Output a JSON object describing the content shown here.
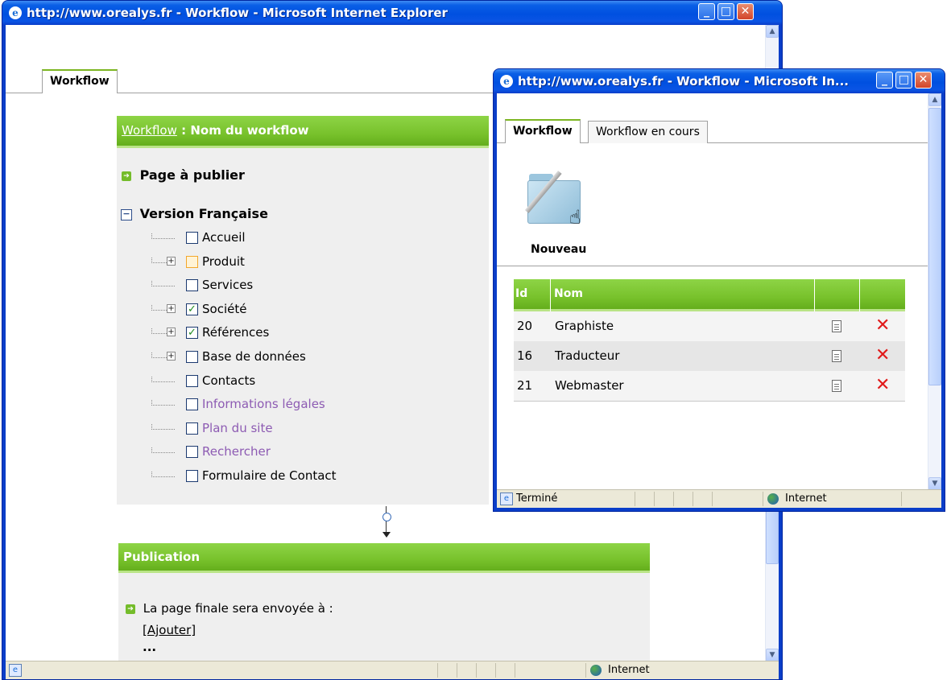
{
  "main_window": {
    "title": "http://www.orealys.fr - Workflow - Microsoft Internet Explorer",
    "tab_label": "Workflow",
    "header": {
      "link": "Workflow",
      "separator": " : ",
      "name": "Nom du workflow"
    },
    "section_page": "Page à publier",
    "section_version": "Version Française",
    "tree_items": [
      {
        "label": "Accueil",
        "expandable": false,
        "checked": false,
        "style": "normal"
      },
      {
        "label": "Produit",
        "expandable": true,
        "checked": false,
        "style": "hover"
      },
      {
        "label": "Services",
        "expandable": false,
        "checked": false,
        "style": "normal"
      },
      {
        "label": "Société",
        "expandable": true,
        "checked": true,
        "style": "normal"
      },
      {
        "label": "Références",
        "expandable": true,
        "checked": true,
        "style": "normal"
      },
      {
        "label": "Base de données",
        "expandable": true,
        "checked": false,
        "style": "normal"
      },
      {
        "label": "Contacts",
        "expandable": false,
        "checked": false,
        "style": "normal"
      },
      {
        "label": "Informations légales",
        "expandable": false,
        "checked": false,
        "style": "purple"
      },
      {
        "label": "Plan du site",
        "expandable": false,
        "checked": false,
        "style": "purple"
      },
      {
        "label": "Rechercher",
        "expandable": false,
        "checked": false,
        "style": "purple"
      },
      {
        "label": "Formulaire de Contact",
        "expandable": false,
        "checked": false,
        "style": "normal"
      }
    ],
    "publication": {
      "title": "Publication",
      "text": "La page finale sera envoyée à :",
      "add_link": "[Ajouter]",
      "ellipsis": "..."
    },
    "status": {
      "zone": "Internet"
    }
  },
  "popup_window": {
    "title": "http://www.orealys.fr - Workflow - Microsoft In...",
    "tabs": [
      "Workflow",
      "Workflow en cours"
    ],
    "new_label": "Nouveau",
    "table": {
      "headers": [
        "Id",
        "Nom",
        "",
        ""
      ],
      "rows": [
        {
          "id": "20",
          "name": "Graphiste"
        },
        {
          "id": "16",
          "name": "Traducteur"
        },
        {
          "id": "21",
          "name": "Webmaster"
        }
      ]
    },
    "status": {
      "text": "Terminé",
      "zone": "Internet"
    }
  },
  "colors": {
    "accent_green": "#78c22c",
    "delete_red": "#e11b1b",
    "xp_blue": "#0a5fe6"
  },
  "icons": [
    "ie-icon",
    "minimize-icon",
    "maximize-icon",
    "close-icon",
    "folder-icon",
    "hand-cursor-icon",
    "document-icon",
    "delete-icon",
    "globe-icon",
    "arrow-bullet-icon",
    "collapse-icon",
    "expand-icon"
  ]
}
